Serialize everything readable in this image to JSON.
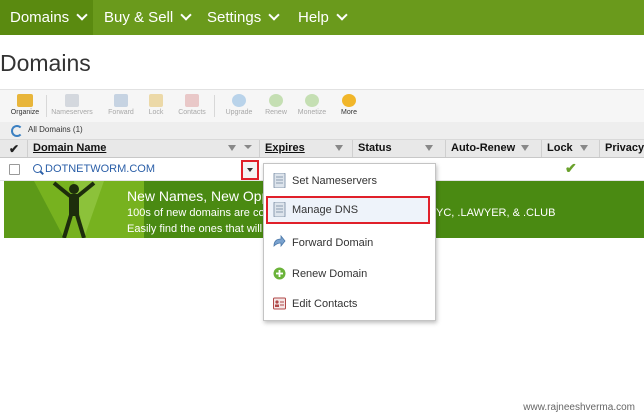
{
  "nav": {
    "items": [
      {
        "label": "Domains"
      },
      {
        "label": "Buy & Sell"
      },
      {
        "label": "Settings"
      },
      {
        "label": "Help"
      }
    ]
  },
  "page": {
    "title": "Domains"
  },
  "toolbar": {
    "organize": "Organize",
    "nameservers": "Nameservers",
    "forward": "Forward",
    "lock": "Lock",
    "contacts": "Contacts",
    "upgrade": "Upgrade",
    "renew": "Renew",
    "monetize": "Monetize",
    "more": "More"
  },
  "breadcrumb": {
    "text": "All Domains (1)"
  },
  "grid": {
    "columns": [
      "Domain Name",
      "Expires",
      "Status",
      "Auto-Renew",
      "Lock",
      "Privacy"
    ],
    "row": {
      "domain": "DOTNETWORM.COM",
      "lock_mark": "✔"
    }
  },
  "banner": {
    "headline": "New Names, New Opp",
    "line2": "100s of new domains are cor",
    "line2_tail": "YC, .LAWYER, & .CLUB",
    "line3": "Easily find the ones that will g"
  },
  "menu": {
    "items": [
      {
        "label": "Set Nameservers"
      },
      {
        "label": "Manage DNS"
      },
      {
        "label": "Forward Domain"
      },
      {
        "label": "Renew Domain"
      },
      {
        "label": "Edit Contacts"
      }
    ]
  },
  "footer": {
    "watermark": "www.rajneeshverma.com"
  },
  "colors": {
    "nav_green": "#6a9a1c",
    "highlight_red": "#e0202a",
    "link_blue": "#2b5fa8"
  }
}
